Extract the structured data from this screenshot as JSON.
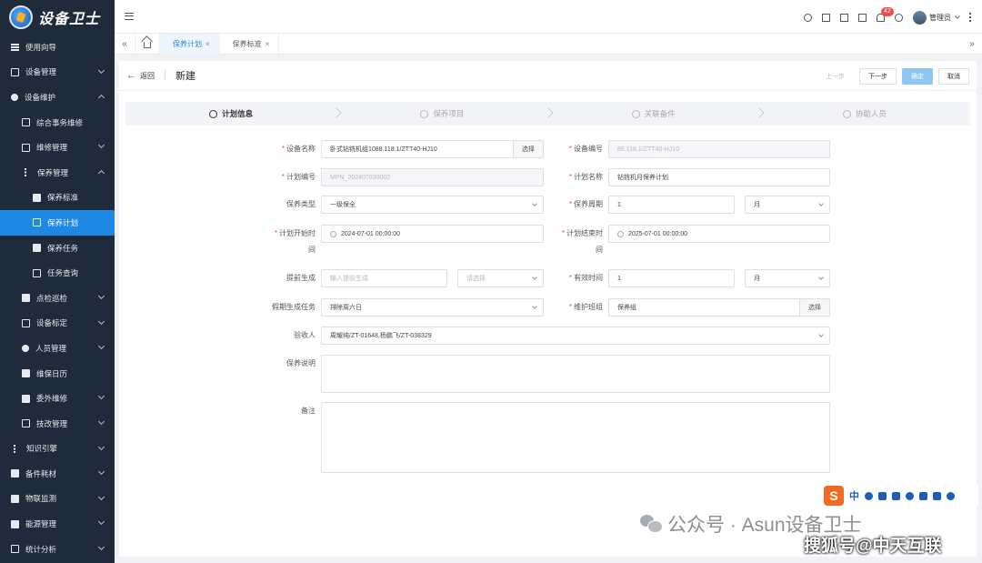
{
  "app": {
    "logo_text": "设备卫士"
  },
  "sidebar": {
    "items": [
      {
        "label": "使用向导",
        "icon": "list-icon",
        "level": 0,
        "expand": ""
      },
      {
        "label": "设备管理",
        "icon": "grid-icon",
        "level": 0,
        "expand": "down"
      },
      {
        "label": "设备维护",
        "icon": "gear-icon",
        "level": 0,
        "expand": "up"
      },
      {
        "label": "综合事务维修",
        "icon": "table-icon",
        "level": 1,
        "expand": ""
      },
      {
        "label": "维修管理",
        "icon": "wrench-doc-icon",
        "level": 1,
        "expand": "down"
      },
      {
        "label": "保养管理",
        "icon": "vertical-dots-icon",
        "level": 1,
        "expand": "up"
      },
      {
        "label": "保养标准",
        "icon": "edit-doc-icon",
        "level": 2,
        "expand": ""
      },
      {
        "label": "保养计划",
        "icon": "plan-doc-icon",
        "level": 2,
        "expand": "",
        "active": true
      },
      {
        "label": "保养任务",
        "icon": "edit-doc-icon",
        "level": 2,
        "expand": ""
      },
      {
        "label": "任务查询",
        "icon": "doc-icon",
        "level": 2,
        "expand": ""
      },
      {
        "label": "点检巡检",
        "icon": "inspect-icon",
        "level": 1,
        "expand": "down"
      },
      {
        "label": "设备标定",
        "icon": "calibrate-icon",
        "level": 1,
        "expand": "down"
      },
      {
        "label": "人员管理",
        "icon": "person-icon",
        "level": 1,
        "expand": "down"
      },
      {
        "label": "维保日历",
        "icon": "calendar-icon",
        "level": 1,
        "expand": ""
      },
      {
        "label": "委外维修",
        "icon": "truck-icon",
        "level": 1,
        "expand": "down"
      },
      {
        "label": "技改管理",
        "icon": "tool-doc-icon",
        "level": 1,
        "expand": "down"
      },
      {
        "label": "知识引擎",
        "icon": "vertical-dots-icon",
        "level": 0,
        "expand": "down"
      },
      {
        "label": "备件耗材",
        "icon": "boxes-icon",
        "level": 0,
        "expand": "down"
      },
      {
        "label": "物联监测",
        "icon": "iot-icon",
        "level": 0,
        "expand": "down"
      },
      {
        "label": "能源管理",
        "icon": "energy-icon",
        "level": 0,
        "expand": "down"
      },
      {
        "label": "统计分析",
        "icon": "chart-icon",
        "level": 0,
        "expand": "down"
      }
    ]
  },
  "topbar": {
    "notification_count": "42",
    "user_name": "管理员"
  },
  "tabs": [
    {
      "label": "保养计划",
      "active": true
    },
    {
      "label": "保养标准",
      "active": false
    }
  ],
  "page": {
    "back_label": "返回",
    "title": "新建",
    "buttons": {
      "prev": "上一步",
      "next": "下一步",
      "confirm": "确定",
      "cancel": "取消"
    }
  },
  "steps": [
    "计划信息",
    "保养项目",
    "关联备件",
    "协助人员"
  ],
  "form": {
    "device_name": {
      "label": "设备名称",
      "value": "卧式钻铣机组1088.118.1/ZTT40-HJ10",
      "button": "选择"
    },
    "device_no": {
      "label": "设备编号",
      "value": "88.118.1/ZTT40-HJ10"
    },
    "plan_no": {
      "label": "计划编号",
      "value": "MPN_202407030002"
    },
    "plan_name": {
      "label": "计划名称",
      "value": "钻铣机月保养计划"
    },
    "maint_type": {
      "label": "保养类型",
      "value": "一级保全"
    },
    "maint_cycle": {
      "label": "保养周期",
      "value": "1",
      "unit": "月"
    },
    "start_time": {
      "label_a": "计划开始时",
      "label_b": "间",
      "value": "2024-07-01 00:00:00"
    },
    "end_time": {
      "label_a": "计划结束时",
      "label_b": "间",
      "value": "2025-07-01 00:00:00"
    },
    "advance_gen": {
      "label": "提前生成",
      "placeholder": "输入提前生成",
      "unit_placeholder": "请选择"
    },
    "valid_time": {
      "label": "有效时间",
      "value": "1",
      "unit": "月"
    },
    "holiday_task": {
      "label": "假期生成任务",
      "value": "排除周六日"
    },
    "maint_group": {
      "label": "维护班组",
      "value": "保养组",
      "button": "选择"
    },
    "acceptor": {
      "label": "验收人",
      "value": "周耀纯/ZT-01648,杨鹏飞/ZT-038329"
    },
    "description": {
      "label": "保养说明"
    },
    "remark": {
      "label": "备注"
    }
  },
  "watermark": {
    "text1": "公众号 · Asun设备卫士",
    "text2": "搜狐号@中天互联",
    "ime_label": "中"
  }
}
